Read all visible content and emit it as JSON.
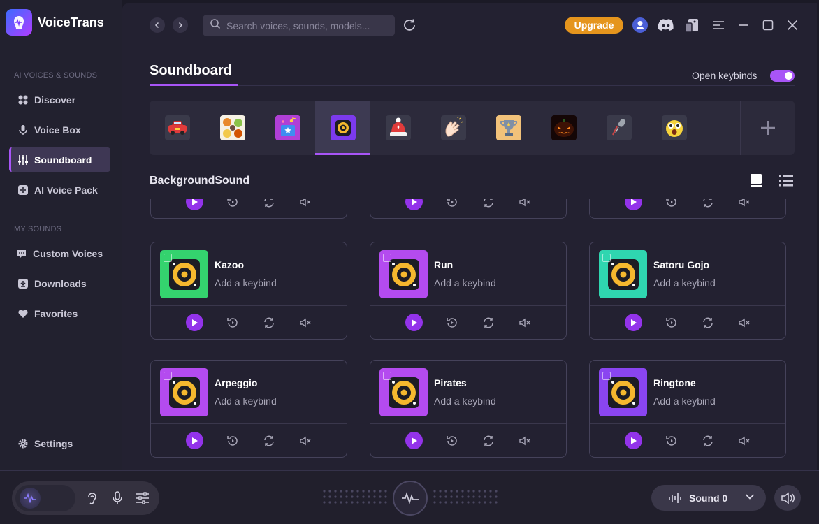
{
  "app": {
    "name": "VoiceTrans",
    "brand_color": "#a855f7",
    "upgrade_color": "#e5951d"
  },
  "sidebar": {
    "section_ai": "AI VOICES & SOUNDS",
    "section_my": "MY SOUNDS",
    "items": [
      {
        "label": "Discover",
        "icon": "discover-icon"
      },
      {
        "label": "Voice Box",
        "icon": "microphone-icon"
      },
      {
        "label": "Soundboard",
        "icon": "sliders-icon",
        "active": true
      },
      {
        "label": "AI Voice Pack",
        "icon": "waveform-box-icon"
      },
      {
        "label": "Custom Voices",
        "icon": "custom-voices-icon"
      },
      {
        "label": "Downloads",
        "icon": "download-icon"
      },
      {
        "label": "Favorites",
        "icon": "heart-icon"
      }
    ],
    "settings_label": "Settings"
  },
  "topbar": {
    "search_placeholder": "Search voices, sounds, models...",
    "upgrade_label": "Upgrade"
  },
  "page": {
    "title": "Soundboard",
    "keybinds_label": "Open keybinds",
    "keybinds_on": true,
    "section_title": "BackgroundSound"
  },
  "categories": [
    {
      "icon": "car-sticker-icon"
    },
    {
      "icon": "cartoon-collage-icon"
    },
    {
      "icon": "music-box-icon"
    },
    {
      "icon": "speaker-icon",
      "active": true
    },
    {
      "icon": "winter-hat-icon"
    },
    {
      "icon": "clapping-hands-icon"
    },
    {
      "icon": "trophy-icon"
    },
    {
      "icon": "pumpkin-icon"
    },
    {
      "icon": "microphone-stand-icon"
    },
    {
      "icon": "surprised-face-icon"
    }
  ],
  "cards": [
    {
      "name": "Kazoo",
      "keybind": "Add a keybind",
      "color": "#34d36e"
    },
    {
      "name": "Run",
      "keybind": "Add a keybind",
      "color": "#b44bef"
    },
    {
      "name": "Satoru Gojo",
      "keybind": "Add a keybind",
      "color": "#2fd6b0"
    },
    {
      "name": "Arpeggio",
      "keybind": "Add a keybind",
      "color": "#b44bef"
    },
    {
      "name": "Pirates",
      "keybind": "Add a keybind",
      "color": "#b44bef"
    },
    {
      "name": "Ringtone",
      "keybind": "Add a keybind",
      "color": "#8a45f0"
    }
  ],
  "bottombar": {
    "sound_label": "Sound 0"
  }
}
